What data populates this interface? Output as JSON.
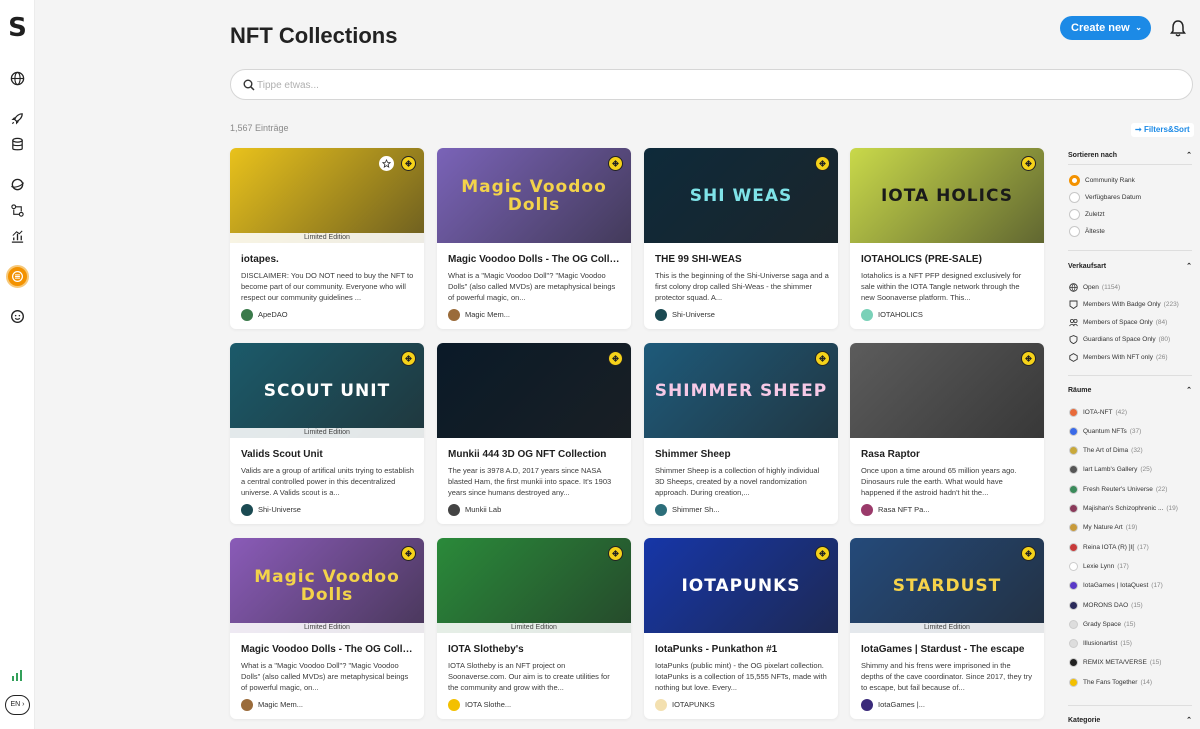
{
  "app": {
    "logo_letter": "S",
    "language": "EN"
  },
  "header": {
    "title": "NFT Collections",
    "create_label": "Create new"
  },
  "search": {
    "placeholder": "Tippe etwas..."
  },
  "results": {
    "count": "1,567 Einträge"
  },
  "filters_label": "Filters&Sort",
  "cards": [
    {
      "title": "iotapes.",
      "desc": "DISCLAIMER: You DO NOT need to buy the NFT to become part of our community. Everyone who will respect our community guidelines ...",
      "owner": "ApeDAO",
      "limited": "Limited Edition",
      "art": "",
      "bg": "#e9c21c",
      "fg": "#222",
      "avatar": "#3a7a4a"
    },
    {
      "title": "Magic Voodoo Dolls - The OG Collection",
      "desc": "What is a \"Magic Voodoo Doll\"? \"Magic Voodoo Dolls\" (also called MVDs) are metaphysical beings of powerful magic, on...",
      "owner": "Magic Mem...",
      "limited": "",
      "art": "Magic Voodoo Dolls",
      "bg": "#7a63b8",
      "fg": "#f3d34a",
      "avatar": "#9a6b3a"
    },
    {
      "title": "THE 99 SHI-WEAS",
      "desc": "This is the beginning of the Shi-Universe saga and a first colony drop called Shi-Weas - the shimmer protector squad. A...",
      "owner": "Shi-Universe",
      "limited": "",
      "art": "SHI WEAS",
      "bg": "#0e2a3a",
      "fg": "#7fe3e8",
      "avatar": "#1b4a52"
    },
    {
      "title": "IOTAHOLICS (PRE-SALE)",
      "desc": "Iotaholics is a NFT PFP designed exclusively for sale within the IOTA Tangle network through the new Soonaverse platform. This...",
      "owner": "IOTAHOLICS",
      "limited": "",
      "art": "IOTA HOLICS",
      "bg": "#c9d94a",
      "fg": "#1a1a1a",
      "avatar": "#7ad1b8"
    },
    {
      "title": "Valids Scout Unit",
      "desc": "Valids are a group of artifical units trying to establish a central controlled power in this decentralized universe. A Valids scout is a...",
      "owner": "Shi-Universe",
      "limited": "Limited Edition",
      "art": "SCOUT UNIT",
      "bg": "#1b5a6a",
      "fg": "#ffffff",
      "avatar": "#1b4a52"
    },
    {
      "title": "Munkii 444 3D OG NFT Collection",
      "desc": "The year is 3978 A.D, 2017 years since NASA blasted Ham, the first munkii into space. It's 1903 years since humans destroyed any...",
      "owner": "Munkii Lab",
      "limited": "",
      "art": "",
      "bg": "#0a1a28",
      "fg": "#ffffff",
      "avatar": "#444444"
    },
    {
      "title": "Shimmer Sheep",
      "desc": "Shimmer Sheep is a collection of highly individual 3D Sheeps, created by a novel randomization approach. During creation,...",
      "owner": "Shimmer Sh...",
      "limited": "",
      "art": "SHIMMER SHEEP",
      "bg": "#1e5a7a",
      "fg": "#f6c9e6",
      "avatar": "#2c6e7a"
    },
    {
      "title": "Rasa Raptor",
      "desc": "Once upon a time around 65 million years ago. Dinosaurs rule the earth. What would have happened if the astroid hadn't hit the...",
      "owner": "Rasa NFT Pa...",
      "limited": "",
      "art": "",
      "bg": "#5c5c5c",
      "fg": "#ffffff",
      "avatar": "#9a3a6a"
    },
    {
      "title": "Magic Voodoo Dolls - The OG Collection",
      "desc": "What is a \"Magic Voodoo Doll\"? \"Magic Voodoo Dolls\" (also called MVDs) are metaphysical beings of powerful magic, on...",
      "owner": "Magic Mem...",
      "limited": "Limited Edition",
      "art": "Magic Voodoo Dolls",
      "bg": "#8a5bb8",
      "fg": "#f3d34a",
      "avatar": "#9a6b3a"
    },
    {
      "title": "IOTA Slotheby's",
      "desc": "IOTA Slotheby is an NFT project on Soonaverse.com. Our aim is to create utilities for the community and grow with the...",
      "owner": "IOTA Slothe...",
      "limited": "Limited Edition",
      "art": "",
      "bg": "#2a8a3a",
      "fg": "#ffffff",
      "avatar": "#f3c000"
    },
    {
      "title": "IotaPunks - Punkathon #1",
      "desc": "IotaPunks (public mint) - the OG pixelart collection. IotaPunks is a collection of 15,555 NFTs, made with nothing but love. Every...",
      "owner": "IOTAPUNKS",
      "limited": "",
      "art": "IOTAPUNKS",
      "bg": "#1636a8",
      "fg": "#ffffff",
      "avatar": "#f3e0b0"
    },
    {
      "title": "IotaGames | Stardust - The escape",
      "desc": "Shimmy and his frens were imprisoned in the depths of the cave coordinator. Since 2017, they try to escape, but fail because of...",
      "owner": "IotaGames |...",
      "limited": "Limited Edition",
      "art": "STARDUST",
      "bg": "#244a7a",
      "fg": "#f6d34a",
      "avatar": "#3a2a7a"
    }
  ],
  "sidebar": {
    "sort": {
      "title": "Sortieren nach",
      "options": [
        {
          "label": "Community Rank",
          "selected": true
        },
        {
          "label": "Verfügbares Datum",
          "selected": false
        },
        {
          "label": "Zuletzt",
          "selected": false
        },
        {
          "label": "Älteste",
          "selected": false
        }
      ]
    },
    "sale": {
      "title": "Verkaufsart",
      "options": [
        {
          "label": "Open",
          "count": "(1154)",
          "icon": "globe-icon"
        },
        {
          "label": "Members With Badge Only",
          "count": "(223)",
          "icon": "badge-icon"
        },
        {
          "label": "Members of Space Only",
          "count": "(84)",
          "icon": "users-icon"
        },
        {
          "label": "Guardians of Space Only",
          "count": "(80)",
          "icon": "shield-icon"
        },
        {
          "label": "Members With NFT only",
          "count": "(26)",
          "icon": "hexagon-icon"
        }
      ]
    },
    "spaces": {
      "title": "Räume",
      "items": [
        {
          "label": "IOTA-NFT",
          "count": "(42)",
          "color": "#e86a3a"
        },
        {
          "label": "Quantum NFTs",
          "count": "(37)",
          "color": "#3a6ae8"
        },
        {
          "label": "The Art of Dima",
          "count": "(32)",
          "color": "#c8a83a"
        },
        {
          "label": "Iart Lamb's Gallery",
          "count": "(25)",
          "color": "#555555"
        },
        {
          "label": "Fresh Reuter's Universe",
          "count": "(22)",
          "color": "#3a8a5a"
        },
        {
          "label": "Majishan's Schizophrenic ...",
          "count": "(19)",
          "color": "#8a3a5a"
        },
        {
          "label": "My Nature Art",
          "count": "(19)",
          "color": "#c89a3a"
        },
        {
          "label": "Reina IOTA (R) ]I[",
          "count": "(17)",
          "color": "#c83a3a"
        },
        {
          "label": "Lexie Lynn",
          "count": "(17)",
          "color": "#ffffff"
        },
        {
          "label": "IotaGames | IotaQuest",
          "count": "(17)",
          "color": "#5a3ac8"
        },
        {
          "label": "MORONS DAO",
          "count": "(15)",
          "color": "#2a2a5a"
        },
        {
          "label": "Grady Space",
          "count": "(15)",
          "color": "#dddddd"
        },
        {
          "label": "Illusionartist",
          "count": "(15)",
          "color": "#dddddd"
        },
        {
          "label": "REMIX META/VERSE",
          "count": "(15)",
          "color": "#222222"
        },
        {
          "label": "The Fans Together",
          "count": "(14)",
          "color": "#f3c000"
        }
      ]
    },
    "category": {
      "title": "Kategorie"
    }
  }
}
